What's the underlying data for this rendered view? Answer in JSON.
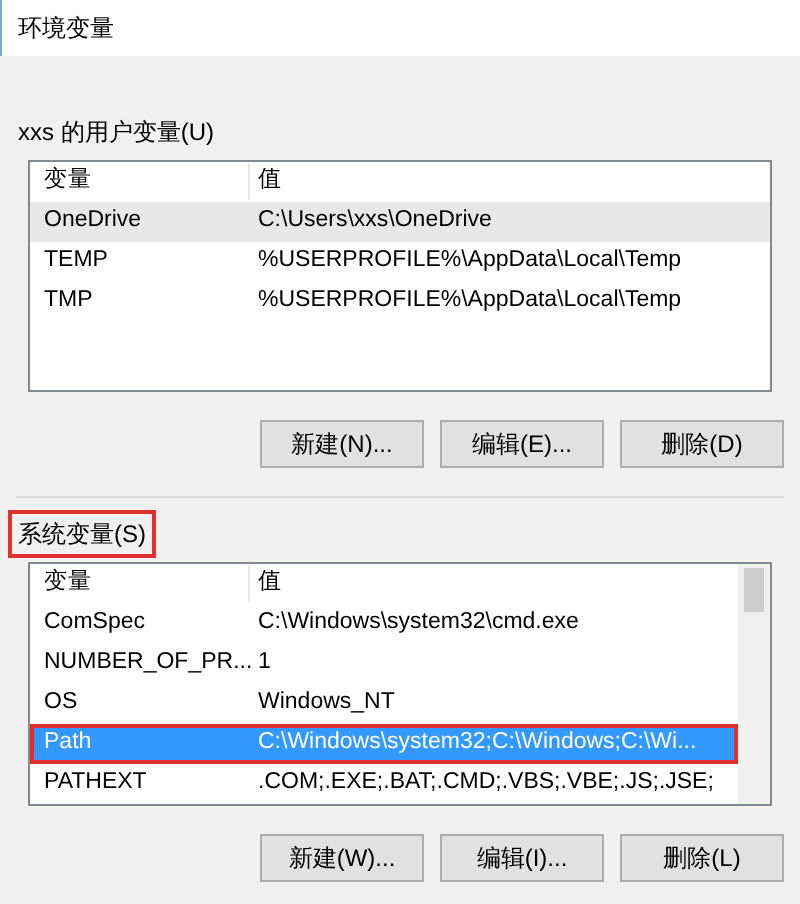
{
  "window": {
    "title": "环境变量"
  },
  "user_vars": {
    "label": "xxs 的用户变量(U)",
    "highlighted": false,
    "columns": [
      "变量",
      "值"
    ],
    "rows": [
      {
        "name": "OneDrive",
        "value": "C:\\Users\\xxs\\OneDrive",
        "selected": false,
        "hover": true,
        "highlighted": false
      },
      {
        "name": "TEMP",
        "value": "%USERPROFILE%\\AppData\\Local\\Temp",
        "selected": false,
        "hover": false,
        "highlighted": false
      },
      {
        "name": "TMP",
        "value": "%USERPROFILE%\\AppData\\Local\\Temp",
        "selected": false,
        "hover": false,
        "highlighted": false
      }
    ],
    "buttons": [
      "新建(N)...",
      "编辑(E)...",
      "删除(D)"
    ]
  },
  "system_vars": {
    "label": "系统变量(S)",
    "highlighted": true,
    "columns": [
      "变量",
      "值"
    ],
    "rows": [
      {
        "name": "ComSpec",
        "value": "C:\\Windows\\system32\\cmd.exe",
        "selected": false,
        "hover": false,
        "highlighted": false
      },
      {
        "name": "NUMBER_OF_PR...",
        "value": "1",
        "selected": false,
        "hover": false,
        "highlighted": false
      },
      {
        "name": "OS",
        "value": "Windows_NT",
        "selected": false,
        "hover": false,
        "highlighted": false
      },
      {
        "name": "Path",
        "value": "C:\\Windows\\system32;C:\\Windows;C:\\Wi...",
        "selected": true,
        "hover": false,
        "highlighted": true
      },
      {
        "name": "PATHEXT",
        "value": ".COM;.EXE;.BAT;.CMD;.VBS;.VBE;.JS;.JSE;",
        "selected": false,
        "hover": false,
        "highlighted": false
      }
    ],
    "buttons": [
      "新建(W)...",
      "编辑(I)...",
      "删除(L)"
    ]
  }
}
